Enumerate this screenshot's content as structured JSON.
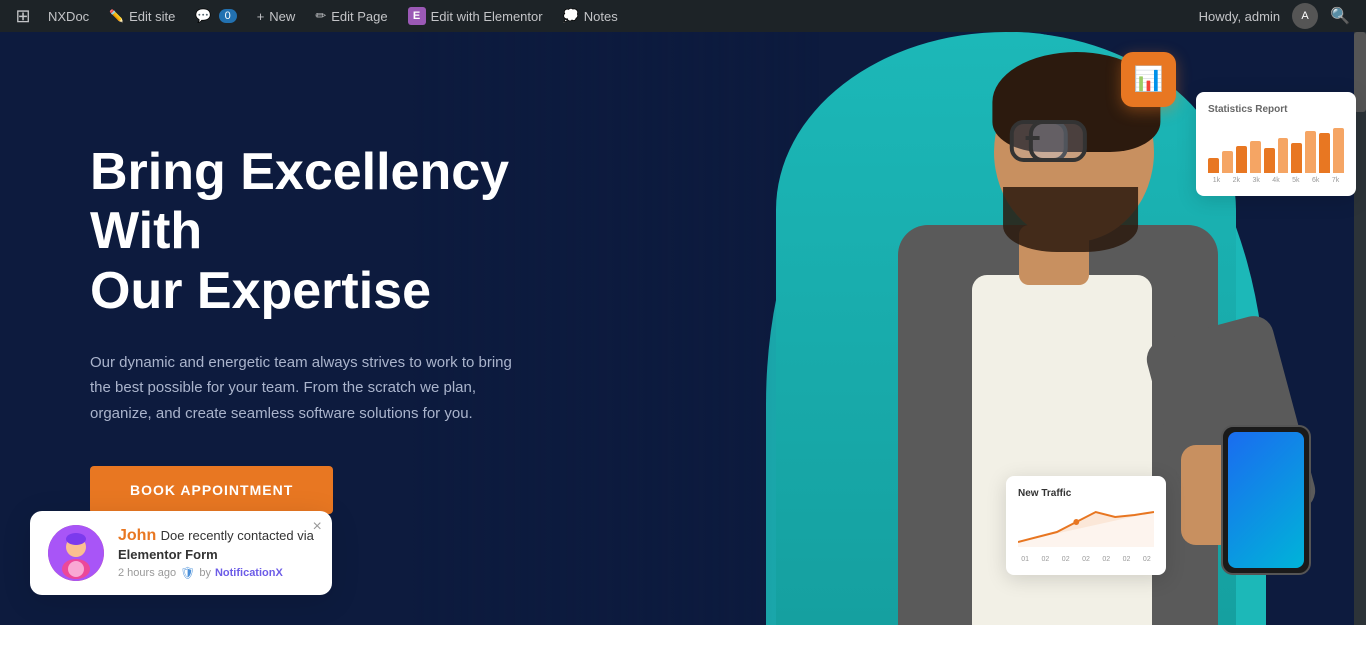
{
  "adminbar": {
    "wp_icon": "⊞",
    "site_name": "NXDoc",
    "edit_site": "Edit site",
    "comments": "0",
    "new": "New",
    "edit_page": "Edit Page",
    "edit_elementor": "Edit with Elementor",
    "notes": "Notes",
    "howdy": "Howdy, admin",
    "elementor_icon": "E"
  },
  "hero": {
    "title_line1": "Bring Excellency With",
    "title_line2": "Our Expertise",
    "description": "Our dynamic and energetic team always strives to work to bring the best possible for your team. From the scratch we plan, organize, and create seamless software solutions for you.",
    "cta_button": "BOOK APPOINTMENT"
  },
  "stats_card": {
    "title": "Statistics Report",
    "bars": [
      30,
      45,
      55,
      65,
      50,
      70,
      60,
      80,
      75,
      85
    ],
    "labels": [
      "1k",
      "2k",
      "3k",
      "4k",
      "5k",
      "6k",
      "7k"
    ]
  },
  "traffic_card": {
    "title": "New Traffic",
    "labels": [
      "01",
      "02",
      "02",
      "02",
      "02",
      "02",
      "02"
    ]
  },
  "notification": {
    "name": "John",
    "message": " Doe recently contacted via",
    "form": "Elementor Form",
    "time": "2 hours ago",
    "by_text": "by",
    "powered_by": "NotificationX",
    "close": "×"
  }
}
